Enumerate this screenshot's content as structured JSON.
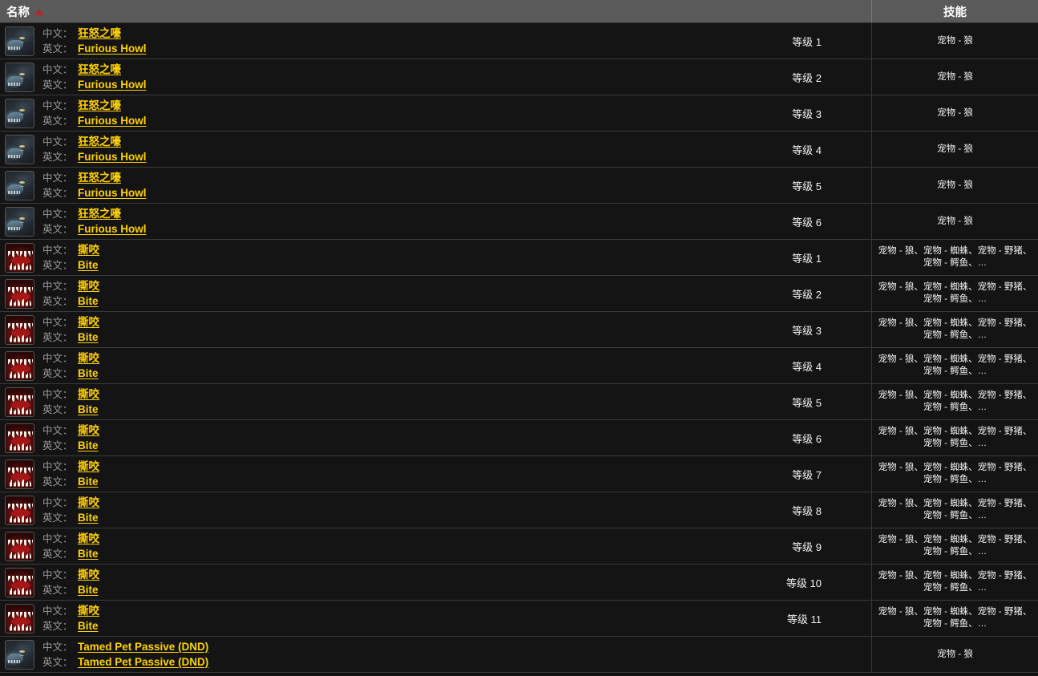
{
  "table": {
    "columns": {
      "name_header": "名称",
      "skill_header": "技能",
      "sort_indicator": "sort-ascending-triangle-icon"
    },
    "labels": {
      "chinese": "中文：",
      "english": "英文："
    },
    "colors": {
      "header_bg": "#5a5a5a",
      "row_bg": "#141414",
      "name_value": "#ffd100",
      "label_grey": "#9a9a9a",
      "sort_triangle": "#b02a2a"
    },
    "rows": [
      {
        "icon": "wolf-head-icon",
        "cn": "狂怒之嚎",
        "en": "Furious Howl",
        "level": "等级 1",
        "skill": "宠物 - 狼"
      },
      {
        "icon": "wolf-head-icon",
        "cn": "狂怒之嚎",
        "en": "Furious Howl",
        "level": "等级 2",
        "skill": "宠物 - 狼"
      },
      {
        "icon": "wolf-head-icon",
        "cn": "狂怒之嚎",
        "en": "Furious Howl",
        "level": "等级 3",
        "skill": "宠物 - 狼"
      },
      {
        "icon": "wolf-head-icon",
        "cn": "狂怒之嚎",
        "en": "Furious Howl",
        "level": "等级 4",
        "skill": "宠物 - 狼"
      },
      {
        "icon": "wolf-head-icon",
        "cn": "狂怒之嚎",
        "en": "Furious Howl",
        "level": "等级 5",
        "skill": "宠物 - 狼"
      },
      {
        "icon": "wolf-head-icon",
        "cn": "狂怒之嚎",
        "en": "Furious Howl",
        "level": "等级 6",
        "skill": "宠物 - 狼"
      },
      {
        "icon": "bite-maw-icon",
        "cn": "撕咬",
        "en": "Bite",
        "level": "等级 1",
        "skill": "宠物 - 狼、宠物 - 蜘蛛、宠物 - 野猪、宠物 - 鳄鱼、…"
      },
      {
        "icon": "bite-maw-icon",
        "cn": "撕咬",
        "en": "Bite",
        "level": "等级 2",
        "skill": "宠物 - 狼、宠物 - 蜘蛛、宠物 - 野猪、宠物 - 鳄鱼、…"
      },
      {
        "icon": "bite-maw-icon",
        "cn": "撕咬",
        "en": "Bite",
        "level": "等级 3",
        "skill": "宠物 - 狼、宠物 - 蜘蛛、宠物 - 野猪、宠物 - 鳄鱼、…"
      },
      {
        "icon": "bite-maw-icon",
        "cn": "撕咬",
        "en": "Bite",
        "level": "等级 4",
        "skill": "宠物 - 狼、宠物 - 蜘蛛、宠物 - 野猪、宠物 - 鳄鱼、…"
      },
      {
        "icon": "bite-maw-icon",
        "cn": "撕咬",
        "en": "Bite",
        "level": "等级 5",
        "skill": "宠物 - 狼、宠物 - 蜘蛛、宠物 - 野猪、宠物 - 鳄鱼、…"
      },
      {
        "icon": "bite-maw-icon",
        "cn": "撕咬",
        "en": "Bite",
        "level": "等级 6",
        "skill": "宠物 - 狼、宠物 - 蜘蛛、宠物 - 野猪、宠物 - 鳄鱼、…"
      },
      {
        "icon": "bite-maw-icon",
        "cn": "撕咬",
        "en": "Bite",
        "level": "等级 7",
        "skill": "宠物 - 狼、宠物 - 蜘蛛、宠物 - 野猪、宠物 - 鳄鱼、…"
      },
      {
        "icon": "bite-maw-icon",
        "cn": "撕咬",
        "en": "Bite",
        "level": "等级 8",
        "skill": "宠物 - 狼、宠物 - 蜘蛛、宠物 - 野猪、宠物 - 鳄鱼、…"
      },
      {
        "icon": "bite-maw-icon",
        "cn": "撕咬",
        "en": "Bite",
        "level": "等级 9",
        "skill": "宠物 - 狼、宠物 - 蜘蛛、宠物 - 野猪、宠物 - 鳄鱼、…"
      },
      {
        "icon": "bite-maw-icon",
        "cn": "撕咬",
        "en": "Bite",
        "level": "等级 10",
        "skill": "宠物 - 狼、宠物 - 蜘蛛、宠物 - 野猪、宠物 - 鳄鱼、…"
      },
      {
        "icon": "bite-maw-icon",
        "cn": "撕咬",
        "en": "Bite",
        "level": "等级 11",
        "skill": "宠物 - 狼、宠物 - 蜘蛛、宠物 - 野猪、宠物 - 鳄鱼、…"
      },
      {
        "icon": "wolf-head-icon",
        "cn": "Tamed Pet Passive (DND)",
        "en": "Tamed Pet Passive (DND)",
        "level": "",
        "skill": "宠物 - 狼"
      }
    ]
  }
}
